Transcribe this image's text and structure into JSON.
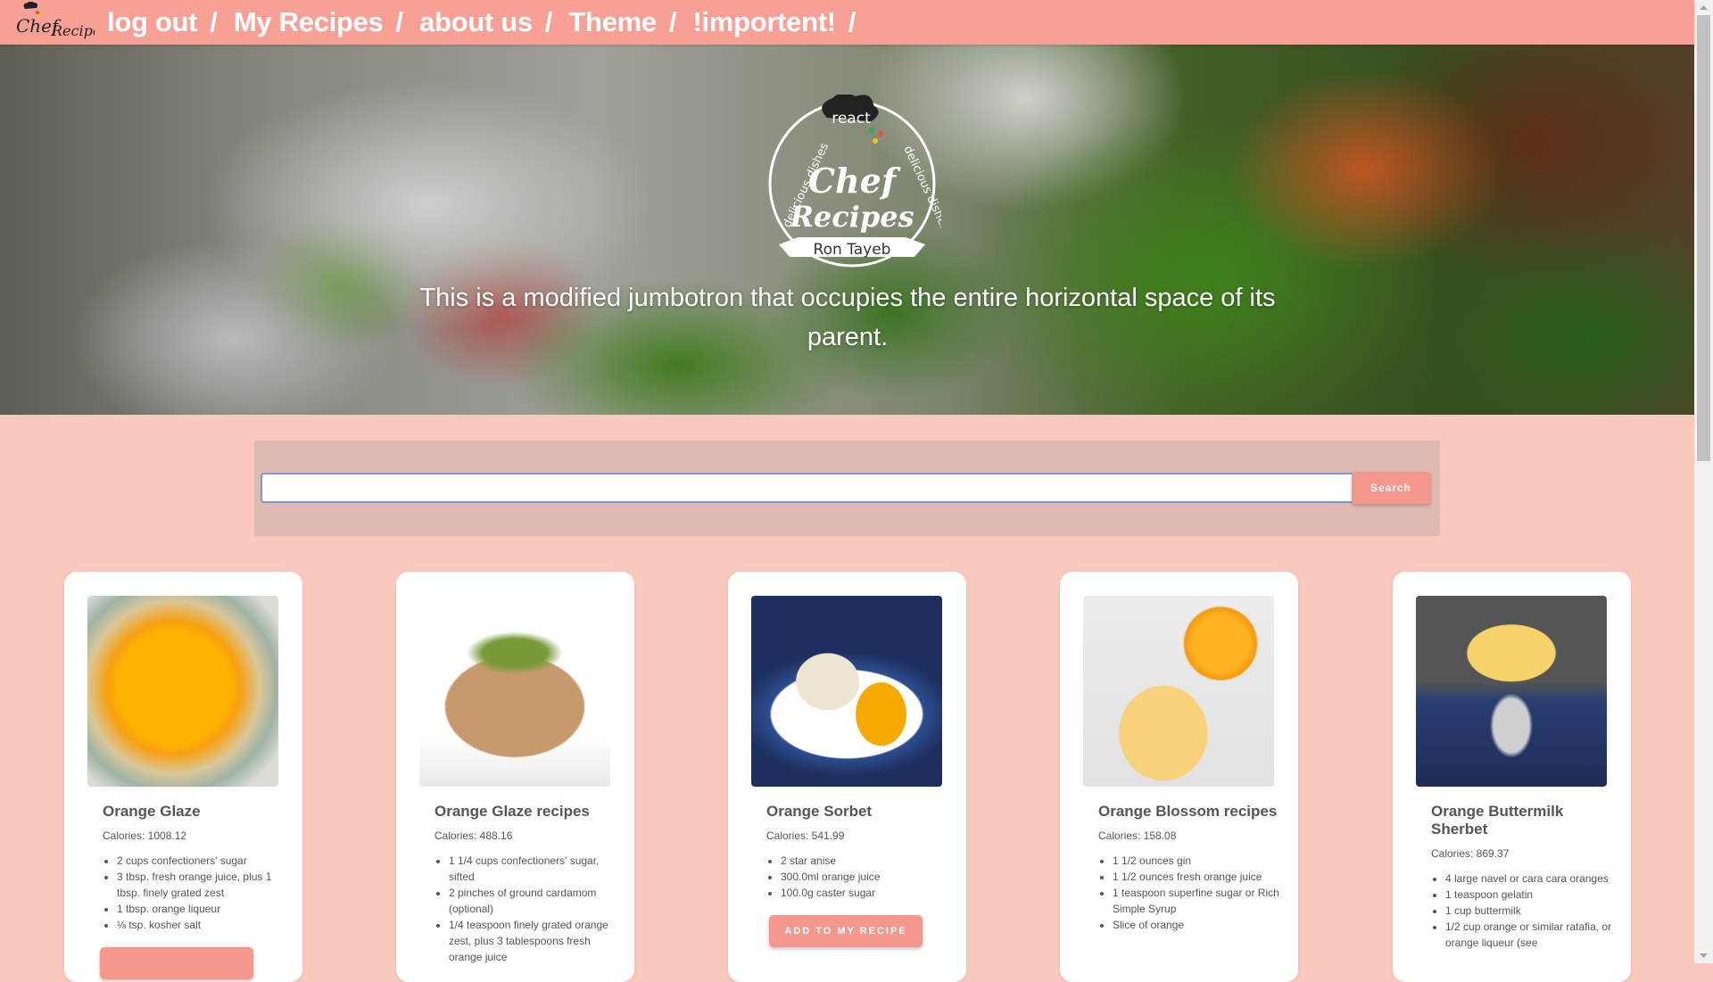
{
  "nav": {
    "logo_text": "Chef Recipes",
    "links": [
      "log out",
      "My Recipes",
      "about us",
      "Theme",
      "!importent!"
    ],
    "separator": "/"
  },
  "hero": {
    "logo": {
      "top": "react",
      "left_arc": "delicious dishes",
      "right_arc": "delicious dishes",
      "main": "Chef Recipes",
      "ribbon": "Ron Tayeb"
    },
    "text": "This is a modified jumbotron that occupies the entire horizontal space of its parent."
  },
  "search": {
    "value": "",
    "button_label": "Search"
  },
  "cards": [
    {
      "title": "Orange Glaze",
      "calories": "Calories: 1008.12",
      "ingredients": [
        "2 cups confectioners' sugar",
        "3 tbsp. fresh orange juice, plus 1 tbsp. finely grated zest",
        "1 tbsp. orange liqueur",
        "⅛ tsp. kosher salt"
      ],
      "button": ""
    },
    {
      "title": "Orange Glaze recipes",
      "calories": "Calories: 488.16",
      "ingredients": [
        "1 1/4 cups confectioners' sugar, sifted",
        "2 pinches of ground cardamom (optional)",
        "1/4 teaspoon finely grated orange zest, plus 3 tablespoons fresh orange juice"
      ],
      "button": ""
    },
    {
      "title": "Orange Sorbet",
      "calories": "Calories: 541.99",
      "ingredients": [
        "2 star anise",
        "300.0ml orange juice",
        "100.0g caster sugar"
      ],
      "button": "ADD TO MY RECIPE"
    },
    {
      "title": "Orange Blossom recipes",
      "calories": "Calories: 158.08",
      "ingredients": [
        "1 1/2 ounces gin",
        "1 1/2 ounces fresh orange juice",
        "1 teaspoon superfine sugar or Rich Simple Syrup",
        "Slice of orange"
      ],
      "button": ""
    },
    {
      "title": "Orange Buttermilk Sherbet",
      "calories": "Calories: 869.37",
      "ingredients": [
        "4 large navel or cara cara oranges",
        "1 teaspoon gelatin",
        "1 cup buttermilk",
        "1/2 cup orange or similar ratafia, or orange liqueur (see"
      ],
      "button": ""
    }
  ],
  "colors": {
    "navbar": "#f9a096",
    "page_bg": "#f9c9bd",
    "accent": "#f6978d",
    "panel": "#dfbab2"
  }
}
